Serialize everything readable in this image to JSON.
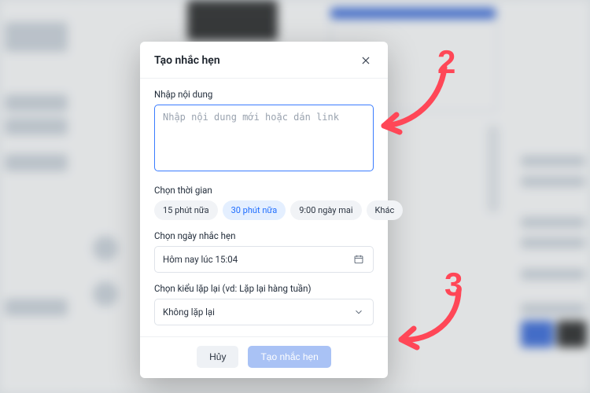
{
  "modal": {
    "title": "Tạo nhắc hẹn",
    "content": {
      "label": "Nhập nội dung",
      "placeholder": "Nhập nội dung mới hoặc dán link",
      "value": ""
    },
    "time": {
      "label": "Chọn thời gian",
      "options": [
        "15 phút nữa",
        "30 phút nữa",
        "9:00 ngày mai",
        "Khác"
      ],
      "selected_index": 1
    },
    "date": {
      "label": "Chọn ngày nhắc hẹn",
      "value": "Hôm nay lúc 15:04"
    },
    "repeat": {
      "label": "Chọn kiểu lặp lại (vd: Lặp lại hàng tuần)",
      "value": "Không lặp lại"
    },
    "footer": {
      "cancel": "Hủy",
      "confirm": "Tạo nhắc hẹn"
    }
  },
  "annotations": {
    "num2": "2",
    "num3": "3"
  }
}
